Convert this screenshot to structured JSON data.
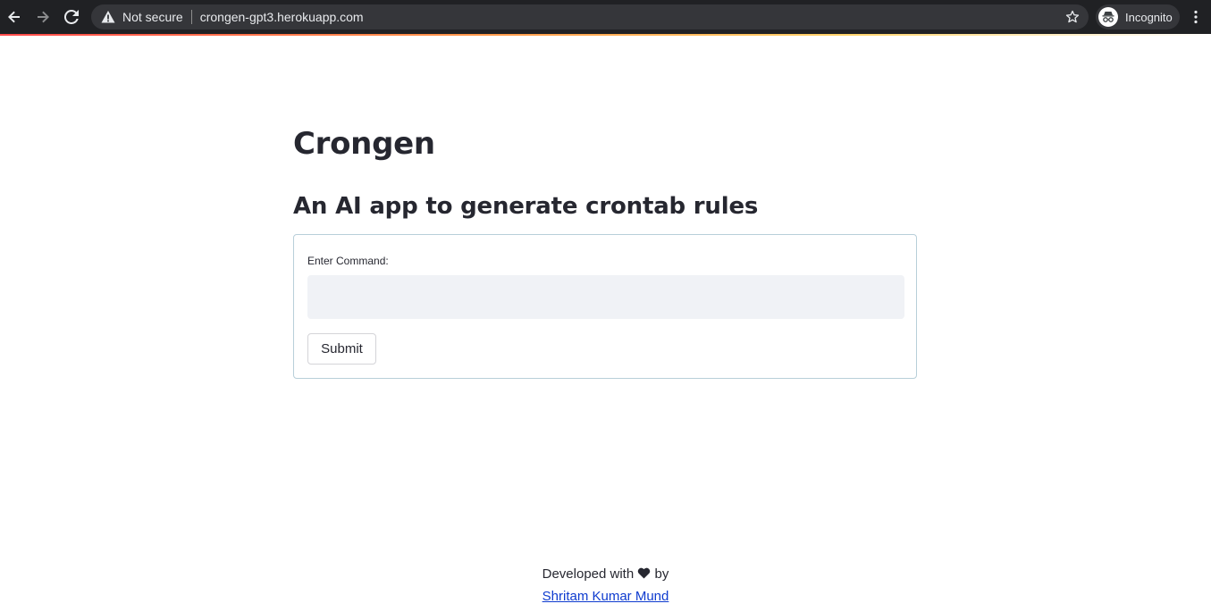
{
  "browser": {
    "security_text": "Not secure",
    "url": "crongen-gpt3.herokuapp.com",
    "incognito_label": "Incognito",
    "icons": [
      "back-icon",
      "forward-icon",
      "reload-icon",
      "warning-icon",
      "star-icon",
      "incognito-icon",
      "menu-icon"
    ]
  },
  "app": {
    "title": "Crongen",
    "subtitle": "An AI app to generate crontab rules"
  },
  "form": {
    "label": "Enter Command:",
    "input_value": "",
    "input_placeholder": "",
    "submit_label": "Submit"
  },
  "footer": {
    "prefix": "Developed with",
    "heart_icon": "heart-icon",
    "suffix": "by",
    "author_link": "Shritam Kumar Mund"
  },
  "colors": {
    "chrome_bg": "#202124",
    "omnibox_bg": "#35363a",
    "text": "#262730",
    "input_bg": "#f0f2f6",
    "form_border": "#b8cfd9",
    "link": "#0e3bcf"
  }
}
